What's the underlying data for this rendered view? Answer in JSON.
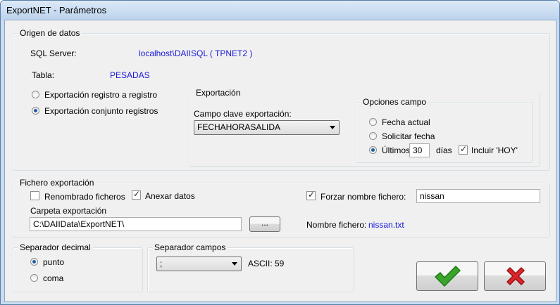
{
  "window": {
    "title": "ExportNET - Parámetros"
  },
  "origen": {
    "legend": "Origen de datos",
    "sql_label": "SQL Server:",
    "sql_value": "localhost\\DAIISQL ( TPNET2 )",
    "tabla_label": "Tabla:",
    "tabla_value": "PESADAS",
    "radio_registro": "Exportación registro a registro",
    "radio_conjunto": "Exportación conjunto registros",
    "exportacion": {
      "legend": "Exportación",
      "campo_label": "Campo clave exportación:",
      "campo_value": "FECHAHORASALIDA",
      "opciones": {
        "legend": "Opciones campo",
        "fecha_actual": "Fecha actual",
        "solicitar_fecha": "Solicitar fecha",
        "ultimos": "Últimos",
        "dias_value": "30",
        "dias_label": "días",
        "incluir_hoy": "Incluir 'HOY'"
      }
    }
  },
  "fichero": {
    "legend": "Fichero exportación",
    "renombrado": "Renombrado ficheros",
    "anexar": "Anexar datos",
    "forzar": "Forzar nombre fichero:",
    "forzar_value": "nissan",
    "carpeta_label": "Carpeta exportación",
    "carpeta_value": "C:\\DAIIData\\ExportNET\\",
    "browse_label": "...",
    "nombre_label": "Nombre fichero:",
    "nombre_value": "nissan.txt"
  },
  "separador_decimal": {
    "legend": "Separador decimal",
    "punto": "punto",
    "coma": "coma"
  },
  "separador_campos": {
    "legend": "Separador campos",
    "value": ";",
    "ascii": "ASCII: 59"
  },
  "colors": {
    "accent_blue": "#1a1ad6",
    "ok_green": "#3aa52b",
    "cancel_red": "#d8262a"
  }
}
